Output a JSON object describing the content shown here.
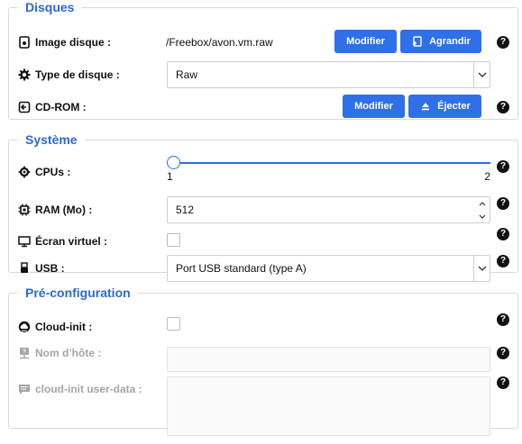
{
  "disques": {
    "legend": "Disques",
    "image_label": "Image disque :",
    "image_value": "/Freebox/avon.vm.raw",
    "modifier_label": "Modifier",
    "agrandir_label": "Agrandir",
    "type_label": "Type de disque :",
    "type_value": "Raw",
    "cdrom_label": "CD-ROM :",
    "cdrom_modifier_label": "Modifier",
    "ejecter_label": "Éjecter"
  },
  "systeme": {
    "legend": "Système",
    "cpus_label": "CPUs :",
    "cpus_min": "1",
    "cpus_max": "2",
    "cpus_value": 1,
    "ram_label": "RAM (Mo) :",
    "ram_value": "512",
    "ecran_label": "Écran virtuel :",
    "ecran_checked": false,
    "usb_label": "USB :",
    "usb_value": "Port USB standard (type A)"
  },
  "preconfig": {
    "legend": "Pré-configuration",
    "cloudinit_label": "Cloud-init :",
    "cloudinit_checked": false,
    "hostname_label": "Nom d’hôte :",
    "hostname_value": "",
    "userdata_label": "cloud-init user-data :",
    "userdata_value": ""
  },
  "help_glyph": "?",
  "colors": {
    "accent": "#2f6fe8",
    "legend": "#2a6ad6",
    "disabled_text": "#a5a5a5"
  }
}
